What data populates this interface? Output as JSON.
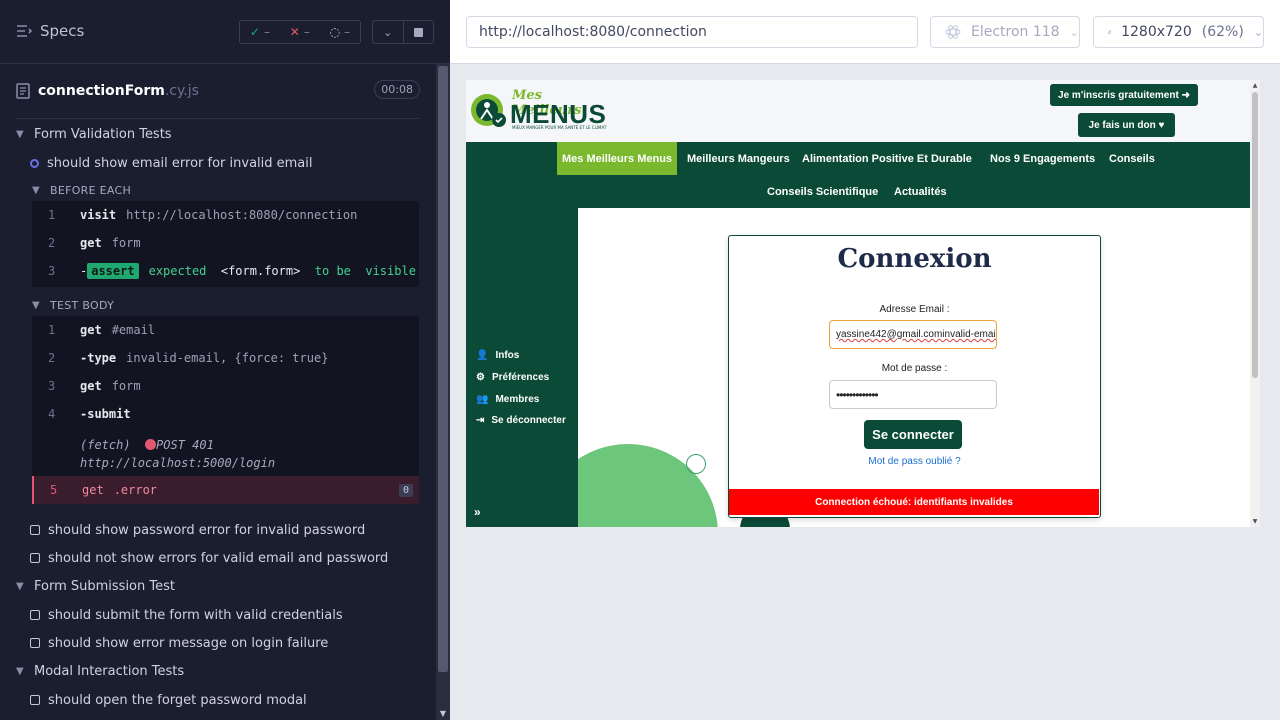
{
  "reporter": {
    "specs_label": "Specs",
    "stats": {
      "passed": "–",
      "failed": "–",
      "pending": "–"
    },
    "spec_file": {
      "name": "connectionForm",
      "ext": ".cy.js",
      "duration": "00:08"
    },
    "suite1": {
      "title": "Form Validation Tests",
      "running_test": "should show email error for invalid email",
      "before_each_label": "BEFORE EACH",
      "before_each": [
        {
          "num": "1",
          "name": "visit",
          "value": "http://localhost:8080/connection"
        },
        {
          "num": "2",
          "name": "get",
          "value": "form"
        },
        {
          "num": "3",
          "badge": "assert",
          "text_expected": "expected",
          "text_target": "<form.form>",
          "text_to_be": "to be",
          "text_state": "visible"
        }
      ],
      "test_body_label": "TEST BODY",
      "test_body": [
        {
          "num": "1",
          "name": "get",
          "value": "#email"
        },
        {
          "num": "2",
          "name": "-type",
          "value": "invalid-email, {force: true}"
        },
        {
          "num": "3",
          "name": "get",
          "value": "form"
        },
        {
          "num": "4",
          "name": "-submit",
          "value": ""
        }
      ],
      "fetch_log": {
        "label": "(fetch)",
        "method": "POST 401",
        "url": "http://localhost:5000/login"
      },
      "failed_cmd": {
        "num": "5",
        "name": "get",
        "value": ".error",
        "count": "0"
      },
      "other_tests": [
        "should show password error for invalid password",
        "should not show errors for valid email and password"
      ]
    },
    "suite2": {
      "title": "Form Submission Test",
      "tests": [
        "should submit the form with valid credentials",
        "should show error message on login failure"
      ]
    },
    "suite3": {
      "title": "Modal Interaction Tests",
      "tests": [
        "should open the forget password modal"
      ]
    }
  },
  "aut_header": {
    "url": "http://localhost:8080/connection",
    "browser": "Electron 118",
    "viewport": "1280x720",
    "zoom": "(62%)"
  },
  "app": {
    "logo": {
      "script": "Mes Meilleurs",
      "main": "MENUS",
      "tagline": "MIEUX MANGER POUR MA SANTÉ ET LE CLIMAT"
    },
    "top_buttons": {
      "signup": "Je m'inscris gratuitement",
      "donate": "Je fais un don"
    },
    "nav": {
      "row1": [
        "Mes Meilleurs Menus",
        "Meilleurs Mangeurs",
        "Alimentation Positive Et Durable",
        "Nos 9 Engagements",
        "Conseils"
      ],
      "row2": [
        "Conseils Scientifique",
        "Actualités"
      ]
    },
    "sidebar": [
      "Infos",
      "Préférences",
      "Membres",
      "Se déconnecter"
    ],
    "form": {
      "title": "Connexion",
      "email_label": "Adresse Email :",
      "email_value": "yassine442@gmail.cominvalid-email",
      "password_label": "Mot de passe :",
      "password_value": "•••••••••••••",
      "submit": "Se connecter",
      "forgot": "Mot de pass oublié ?",
      "error": "Connection échoué: identifiants invalides"
    }
  },
  "colors": {
    "brand_green": "#0b4a36",
    "accent_green": "#7ab82e",
    "error_red": "#ff0000",
    "reporter_bg": "#1b1e2e"
  }
}
